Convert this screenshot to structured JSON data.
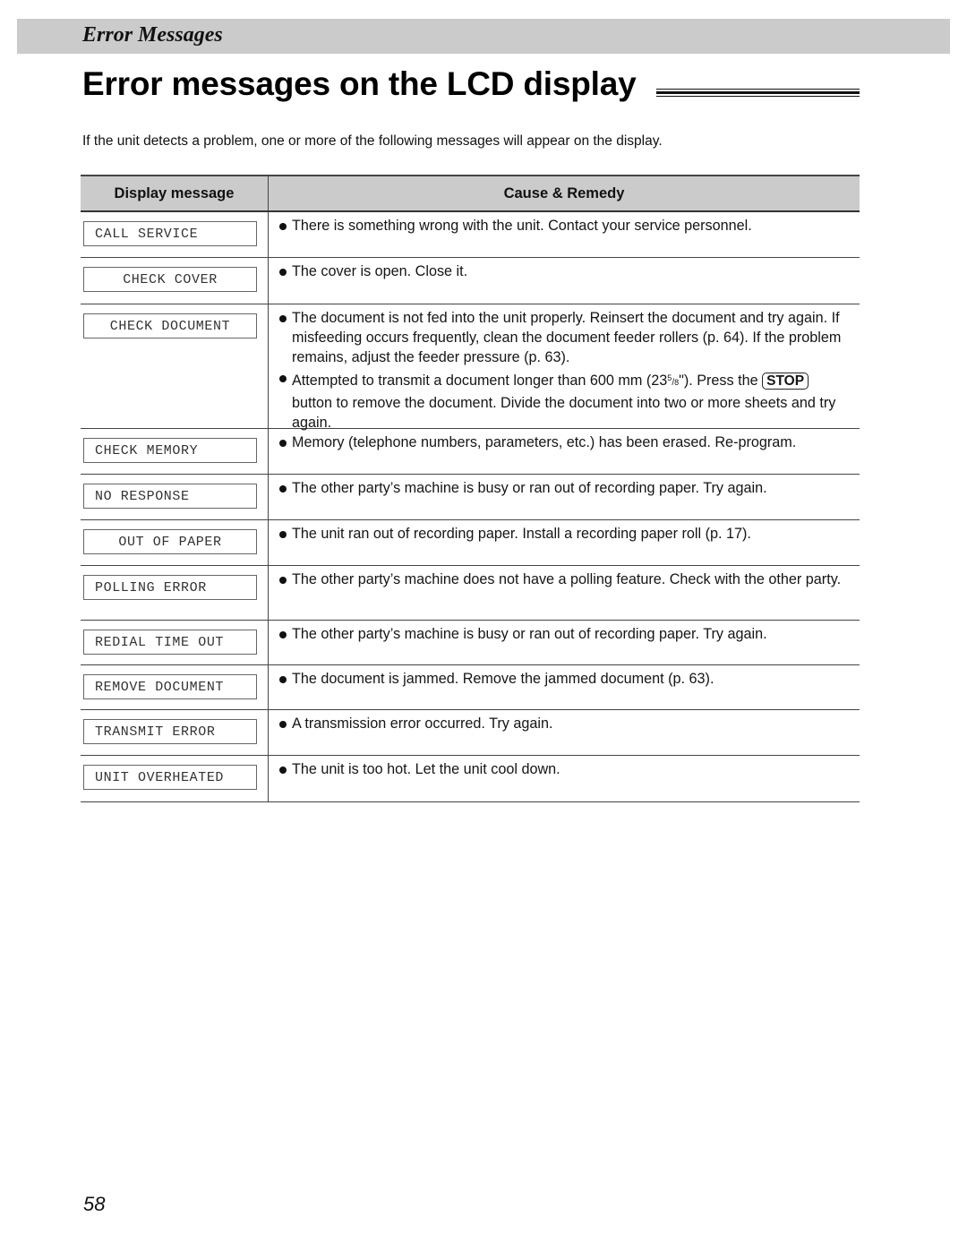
{
  "section": {
    "title": "Error Messages"
  },
  "page_title": "Error messages on the LCD display",
  "intro": "If the unit detects a problem, one or more of the following messages will appear on the display.",
  "table": {
    "headers": {
      "display_message": "Display message",
      "cause_remedy": "Cause & Remedy"
    },
    "rows": [
      {
        "message": "CALL SERVICE",
        "align": "left",
        "items": [
          {
            "text": "There is something wrong with the unit. Contact your service personnel."
          }
        ]
      },
      {
        "message": "CHECK COVER",
        "align": "center",
        "items": [
          {
            "text": "The cover is open. Close it."
          }
        ]
      },
      {
        "message": "CHECK DOCUMENT",
        "align": "center",
        "items": [
          {
            "text": "The document is not fed into the unit properly. Reinsert the document and try again. If misfeeding occurs frequently, clean the document feeder rollers (p. 64). If the problem remains, adjust the feeder pressure (p. 63)."
          },
          {
            "text_before": "Attempted to transmit a document longer than 600 mm (23",
            "fraction_num": "5",
            "fraction_den": "8",
            "text_mid": "\"). Press the ",
            "key": "STOP",
            "text_after": " button to remove the document. Divide the document into two or more sheets and try again."
          }
        ]
      },
      {
        "message": "CHECK MEMORY",
        "align": "left",
        "items": [
          {
            "text": "Memory (telephone numbers, parameters, etc.) has been erased. Re-program."
          }
        ]
      },
      {
        "message": "NO RESPONSE",
        "align": "left",
        "items": [
          {
            "text": "The other party’s machine is busy or ran out of recording paper. Try again."
          }
        ]
      },
      {
        "message": "OUT OF PAPER",
        "align": "center",
        "items": [
          {
            "text": "The unit ran out of recording paper. Install a recording paper roll (p. 17)."
          }
        ]
      },
      {
        "message": "POLLING ERROR",
        "align": "left",
        "items": [
          {
            "text": "The other party’s machine does not have a polling feature. Check with the other party."
          }
        ]
      },
      {
        "message": "REDIAL TIME OUT",
        "align": "left",
        "items": [
          {
            "text": "The other party’s machine is busy or ran out of recording paper. Try again."
          }
        ]
      },
      {
        "message": "REMOVE DOCUMENT",
        "align": "left",
        "items": [
          {
            "text": "The document is jammed. Remove the jammed document (p. 63)."
          }
        ]
      },
      {
        "message": "TRANSMIT ERROR",
        "align": "left",
        "items": [
          {
            "text": "A transmission error occurred. Try again."
          }
        ]
      },
      {
        "message": "UNIT OVERHEATED",
        "align": "left",
        "items": [
          {
            "text": "The unit is too hot. Let the unit cool down."
          }
        ]
      }
    ]
  },
  "page_number": "58"
}
